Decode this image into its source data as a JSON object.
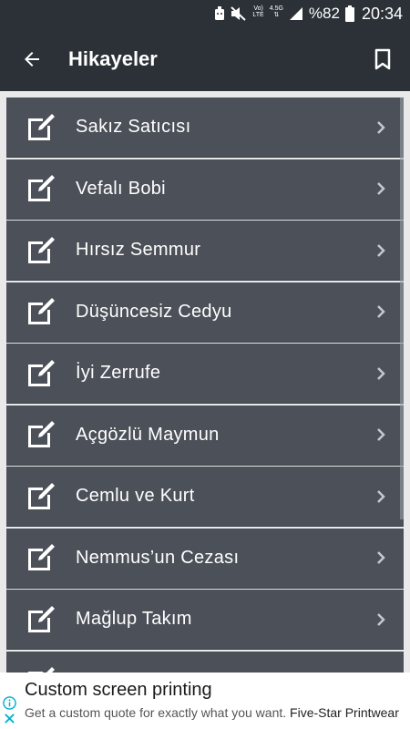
{
  "status_bar": {
    "network_top": "Vo)",
    "network_bottom": "LTE",
    "network_gen": "4.5G",
    "battery_percent": "%82",
    "time": "20:34"
  },
  "app_bar": {
    "title": "Hikayeler",
    "back_icon": "arrow-left",
    "bookmark_icon": "bookmark"
  },
  "stories": [
    {
      "title": "Sakız Satıcısı"
    },
    {
      "title": "Vefalı Bobi"
    },
    {
      "title": "Hırsız Semmur"
    },
    {
      "title": "Düşüncesiz Cedyu"
    },
    {
      "title": "İyi Zerrufe"
    },
    {
      "title": "Açgözlü Maymun"
    },
    {
      "title": "Cemlu ve Kurt"
    },
    {
      "title": "Nemmus’un Cezası"
    },
    {
      "title": "Mağlup Takım"
    },
    {
      "title": ""
    }
  ],
  "ad": {
    "headline": "Custom screen printing",
    "body": "Get a custom quote for exactly what you want.",
    "brand": "Five-Star Printwear"
  },
  "colors": {
    "bar": "#2b3137",
    "row": "#4b5059",
    "background": "#e9e9e9",
    "ad_icon": "#00aecd"
  }
}
